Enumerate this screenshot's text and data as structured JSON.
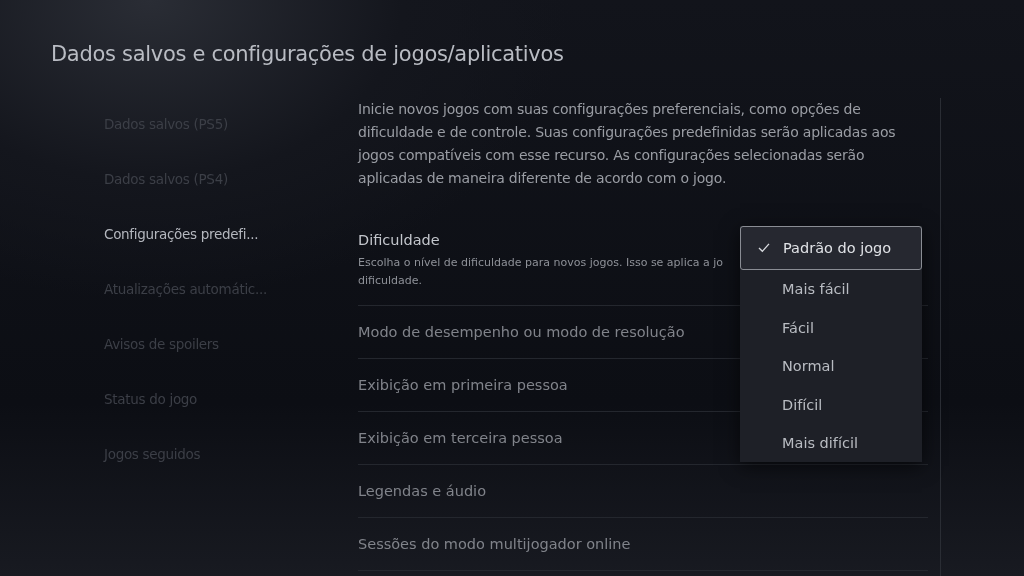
{
  "title": "Dados salvos e configurações de jogos/aplicativos",
  "sidebar": {
    "items": [
      {
        "label": "Dados salvos (PS5)",
        "selected": false
      },
      {
        "label": "Dados salvos (PS4)",
        "selected": false
      },
      {
        "label": "Configurações predefi...",
        "selected": true
      },
      {
        "label": "Atualizações automátic...",
        "selected": false
      },
      {
        "label": "Avisos de spoilers",
        "selected": false
      },
      {
        "label": "Status do jogo",
        "selected": false
      },
      {
        "label": "Jogos seguidos",
        "selected": false
      }
    ]
  },
  "intro": "Inicie novos jogos com suas configurações preferenciais, como opções de dificuldade e de controle. Suas configurações predefinidas serão aplicadas aos jogos compatíveis com esse recurso. As configurações selecionadas serão aplicadas de maneira diferente de acordo com o jogo.",
  "settings": [
    {
      "label": "Dificuldade",
      "description_lines": [
        "Escolha o nível de dificuldade para novos jogos. Isso se aplica a jo",
        "dificuldade."
      ]
    },
    {
      "label": "Modo de desempenho ou modo de resolução"
    },
    {
      "label": "Exibição em primeira pessoa"
    },
    {
      "label": "Exibição em terceira pessoa"
    },
    {
      "label": "Legendas e áudio"
    },
    {
      "label": "Sessões do modo multijogador online"
    }
  ],
  "dropdown": {
    "options": [
      {
        "label": "Padrão do jogo",
        "selected": true
      },
      {
        "label": "Mais fácil",
        "selected": false
      },
      {
        "label": "Fácil",
        "selected": false
      },
      {
        "label": "Normal",
        "selected": false
      },
      {
        "label": "Difícil",
        "selected": false
      },
      {
        "label": "Mais difícil",
        "selected": false
      }
    ]
  }
}
